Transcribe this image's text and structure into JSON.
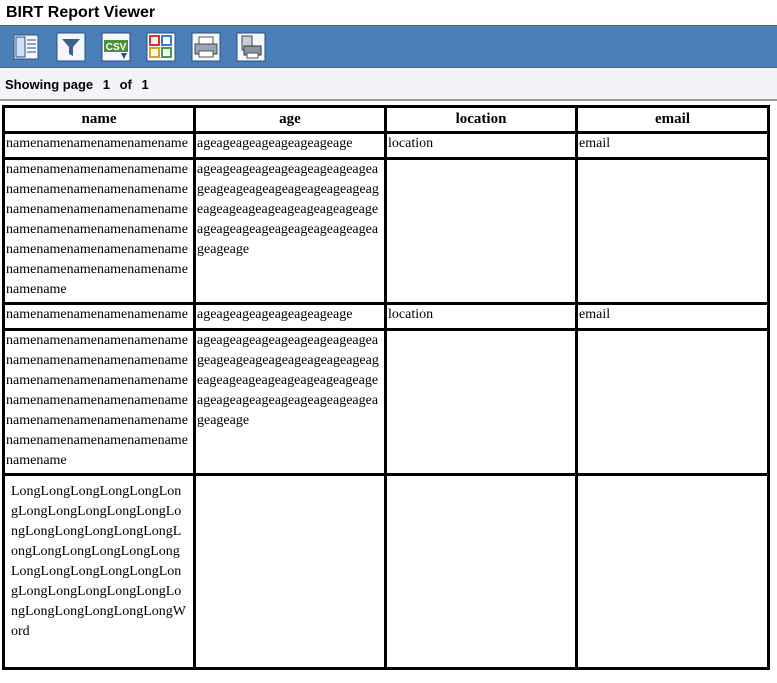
{
  "app": {
    "title": "BIRT Report Viewer"
  },
  "toolbar": {
    "buttons": [
      {
        "name": "toc-button",
        "icon": "table-of-contents-icon"
      },
      {
        "name": "filter-button",
        "icon": "filter-icon"
      },
      {
        "name": "export-csv-button",
        "icon": "csv-export-icon",
        "badge": "CSV"
      },
      {
        "name": "export-report-button",
        "icon": "export-report-icon"
      },
      {
        "name": "print-button",
        "icon": "printer-icon"
      },
      {
        "name": "print-server-button",
        "icon": "server-printer-icon"
      }
    ]
  },
  "paging": {
    "showing_label": "Showing page",
    "current": "1",
    "of_label": "of",
    "total": "1"
  },
  "table": {
    "headers": [
      "name",
      "age",
      "location",
      "email"
    ],
    "rows": [
      [
        "namenamenamenamenamename",
        "ageageageageageageageage",
        "location",
        "email"
      ],
      [
        "namenamenamenamenamenamenamenamenamenamenamenamenamenamenamenamenamenamenamenamenamenamenamenamenamenamenamenamenamenamenamenamenamenamenamenamenamename",
        "ageageageageageageageageageageageageageageageageageageageageageageageageageageageageageageageageageageageageageageageage",
        "",
        ""
      ],
      [
        "namenamenamenamenamename",
        "ageageageageageageageage",
        "location",
        "email"
      ],
      [
        "namenamenamenamenamenamenamenamenamenamenamenamenamenamenamenamenamenamenamenamenamenamenamenamenamenamenamenamenamenamenamenamenamenamenamenamenamename",
        "ageageageageageageageageageageageageageageageageageageageageageageageageageageageageageageageageageageageageageageageage",
        "",
        ""
      ],
      [
        "LongLongLongLongLongLongLongLongLongLongLongLongLongLongLongLongLongLongLongLongLongLongLongLongLongLongLongLongLongLongLongLongLongLongLongLongLongLongLongLongWord",
        "",
        "",
        ""
      ]
    ]
  },
  "colors": {
    "toolbar": "#4a7fb8",
    "pagebar": "#f2f4f8"
  }
}
